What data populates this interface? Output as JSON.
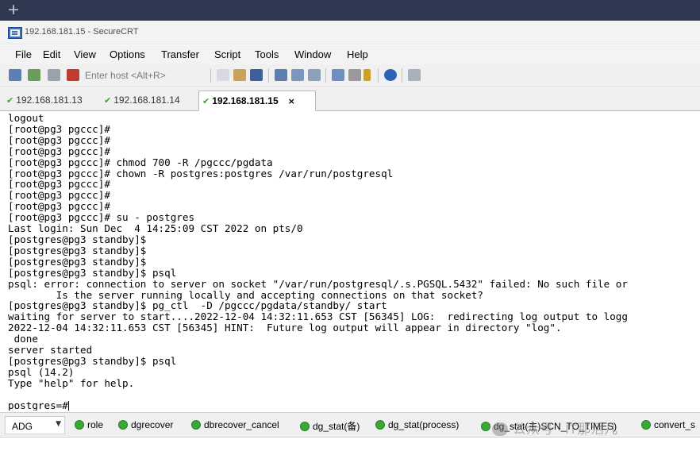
{
  "topbar": {
    "new_tab_glyph": "+"
  },
  "window": {
    "title": "192.168.181.15 - SecureCRT",
    "icon": "securecrt-app-icon"
  },
  "menubar": {
    "items": [
      "File",
      "Edit",
      "View",
      "Options",
      "Transfer",
      "Script",
      "Tools",
      "Window",
      "Help"
    ]
  },
  "toolbar": {
    "host_placeholder": "Enter host <Alt+R>"
  },
  "tabs": [
    {
      "label": "192.168.181.13",
      "active": false
    },
    {
      "label": "192.168.181.14",
      "active": false
    },
    {
      "label": "192.168.181.15",
      "active": true,
      "close": "×"
    }
  ],
  "terminal": {
    "lines": [
      "logout",
      "[root@pg3 pgccc]#",
      "[root@pg3 pgccc]#",
      "[root@pg3 pgccc]#",
      "[root@pg3 pgccc]# chmod 700 -R /pgccc/pgdata",
      "[root@pg3 pgccc]# chown -R postgres:postgres /var/run/postgresql",
      "[root@pg3 pgccc]#",
      "[root@pg3 pgccc]#",
      "[root@pg3 pgccc]#",
      "[root@pg3 pgccc]# su - postgres",
      "Last login: Sun Dec  4 14:25:09 CST 2022 on pts/0",
      "[postgres@pg3 standby]$",
      "[postgres@pg3 standby]$",
      "[postgres@pg3 standby]$",
      "[postgres@pg3 standby]$ psql",
      "psql: error: connection to server on socket \"/var/run/postgresql/.s.PGSQL.5432\" failed: No such file or",
      "        Is the server running locally and accepting connections on that socket?",
      "[postgres@pg3 standby]$ pg_ctl  -D /pgccc/pgdata/standby/ start",
      "waiting for server to start....2022-12-04 14:32:11.653 CST [56345] LOG:  redirecting log output to logg",
      "2022-12-04 14:32:11.653 CST [56345] HINT:  Future log output will appear in directory \"log\".",
      " done",
      "server started",
      "[postgres@pg3 standby]$ psql",
      "psql (14.2)",
      "Type \"help\" for help.",
      "",
      "postgres=#"
    ]
  },
  "buttonbar": {
    "selected": "ADG",
    "buttons": [
      "role",
      "dgrecover",
      "dbrecover_cancel",
      "dg_stat(备)",
      "dg_stat(process)",
      "dg_stat(主)SCN_TO_TIMES)",
      "convert_s"
    ]
  },
  "watermark": {
    "text": "公众号 · IT那活儿"
  },
  "colors": {
    "topbar": "#2f3850",
    "connected_check": "#3aa52b",
    "button_dot": "#39a935"
  }
}
